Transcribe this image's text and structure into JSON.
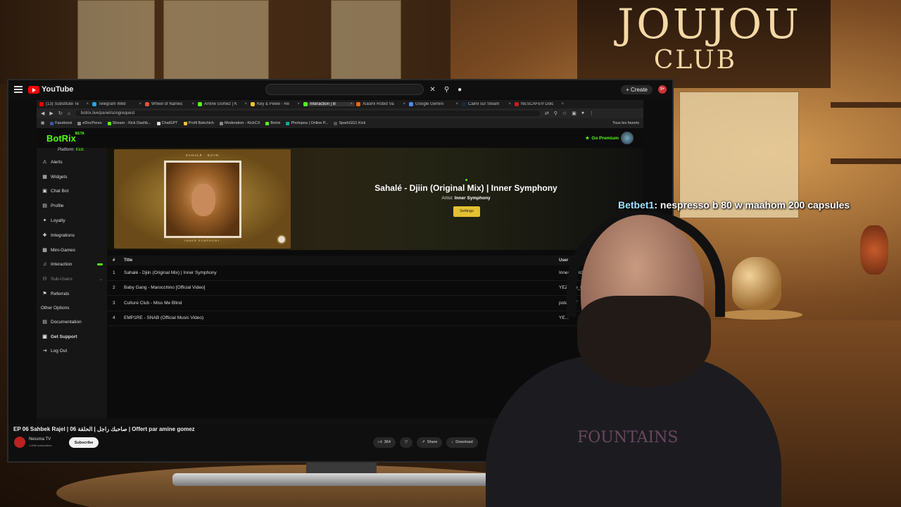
{
  "scene": {
    "sign_line1": "JOUJOU",
    "sign_line2": "CLUB",
    "shirt_print": "FOUNTAINS"
  },
  "chat": {
    "username": "Betbet1",
    "message": ": nespresso b 80 w maahom 200 capsules"
  },
  "youtube": {
    "logo_text": "YouTube",
    "create_label": "Create",
    "notification_count": "9+",
    "video_title": "EP 06 Sahbek Rajel | صاحبك راجل | الحلقة 06 | Offert par amine gomez",
    "channel_name": "Nessma TV",
    "channel_subs": "1.83M subscribers",
    "subscribe_label": "Subscribe",
    "like_count": "364",
    "share_label": "Share",
    "download_label": "Download"
  },
  "browser": {
    "tabs": [
      {
        "label": "(13) Substitute Te",
        "color": "#ff0000"
      },
      {
        "label": "Telegram Web",
        "color": "#2aa3e0"
      },
      {
        "label": "Wheel of Names",
        "color": "#e0533a"
      },
      {
        "label": "Amine Gomez | K",
        "color": "#53fc18"
      },
      {
        "label": "Key & Peele - Re",
        "color": "#f2c230"
      },
      {
        "label": "Interaction | B",
        "color": "#53fc18"
      },
      {
        "label": "Xiaomi Robot Va",
        "color": "#ff6700"
      },
      {
        "label": "Google Gemini",
        "color": "#4a8af4"
      },
      {
        "label": "Caimi sur Steam",
        "color": "#1b2838"
      },
      {
        "label": "NESCAFÉ® Dolc",
        "color": "#c21e1e"
      }
    ],
    "url": "botrix.live/panel/songrequest",
    "bookmarks": [
      {
        "label": "Facebook",
        "color": "#3b5998"
      },
      {
        "label": "eDocPerso",
        "color": "#888888"
      },
      {
        "label": "Stream - Kick Dashb...",
        "color": "#53fc18"
      },
      {
        "label": "ChatGPT",
        "color": "#dddddd"
      },
      {
        "label": "Profil Bakchich",
        "color": "#f2c230"
      },
      {
        "label": "Moderation - KickCX",
        "color": "#888888"
      },
      {
        "label": "Botrix",
        "color": "#53fc18"
      },
      {
        "label": "Photopea | Online P...",
        "color": "#18a497"
      },
      {
        "label": "SparkGG1 Kick",
        "color": "#555555"
      }
    ],
    "bookmarks_right": "Tous les favoris"
  },
  "botrix": {
    "logo": "BotRix",
    "beta": "BETA",
    "go_premium": "Go Premium",
    "platform_label": "Platform:",
    "platform_value": "Kick",
    "sidebar": [
      {
        "label": "Alerts",
        "icon": "⚠"
      },
      {
        "label": "Widgets",
        "icon": "▦"
      },
      {
        "label": "Chat Bot",
        "icon": "▣"
      },
      {
        "label": "Profile",
        "icon": "▤"
      },
      {
        "label": "Loyalty",
        "icon": "✦"
      },
      {
        "label": "Integrations",
        "icon": "✚"
      },
      {
        "label": "Mini-Games",
        "icon": "▩"
      },
      {
        "label": "Interaction",
        "icon": "♫"
      },
      {
        "label": "Sub-Users",
        "icon": "⚇"
      },
      {
        "label": "Referrals",
        "icon": "⚑"
      }
    ],
    "other_options_label": "Other Options",
    "other_options": [
      {
        "label": "Documentation",
        "icon": "▤"
      },
      {
        "label": "Get Support",
        "icon": "▣"
      },
      {
        "label": "Log Out",
        "icon": "⇥"
      }
    ],
    "now_playing": {
      "album_top": "SAHALÉ - DJIIN",
      "album_bottom": "INNER SYMPHONY",
      "title": "Sahalé - Djiin (Original Mix) | Inner Symphony",
      "artist_label": "Artist:",
      "artist": "Inner Symphony",
      "settings_label": "Settings"
    },
    "queue": {
      "headers": {
        "num": "#",
        "title": "Title",
        "user": "User"
      },
      "rows": [
        {
          "num": "1",
          "title": "Sahalé - Djiin (Original Mix) | Inner Symphony",
          "user": "Innervision333"
        },
        {
          "num": "2",
          "title": "Baby Gang - Marocchino [Official Video]",
          "user": "YEZI_ble_bre"
        },
        {
          "num": "3",
          "title": "Culture Club - Miss Me Blind",
          "user": "potatoHT"
        },
        {
          "num": "4",
          "title": "EMP1RE - SNAB (Official Music Video)",
          "user": "YE..."
        }
      ]
    }
  }
}
